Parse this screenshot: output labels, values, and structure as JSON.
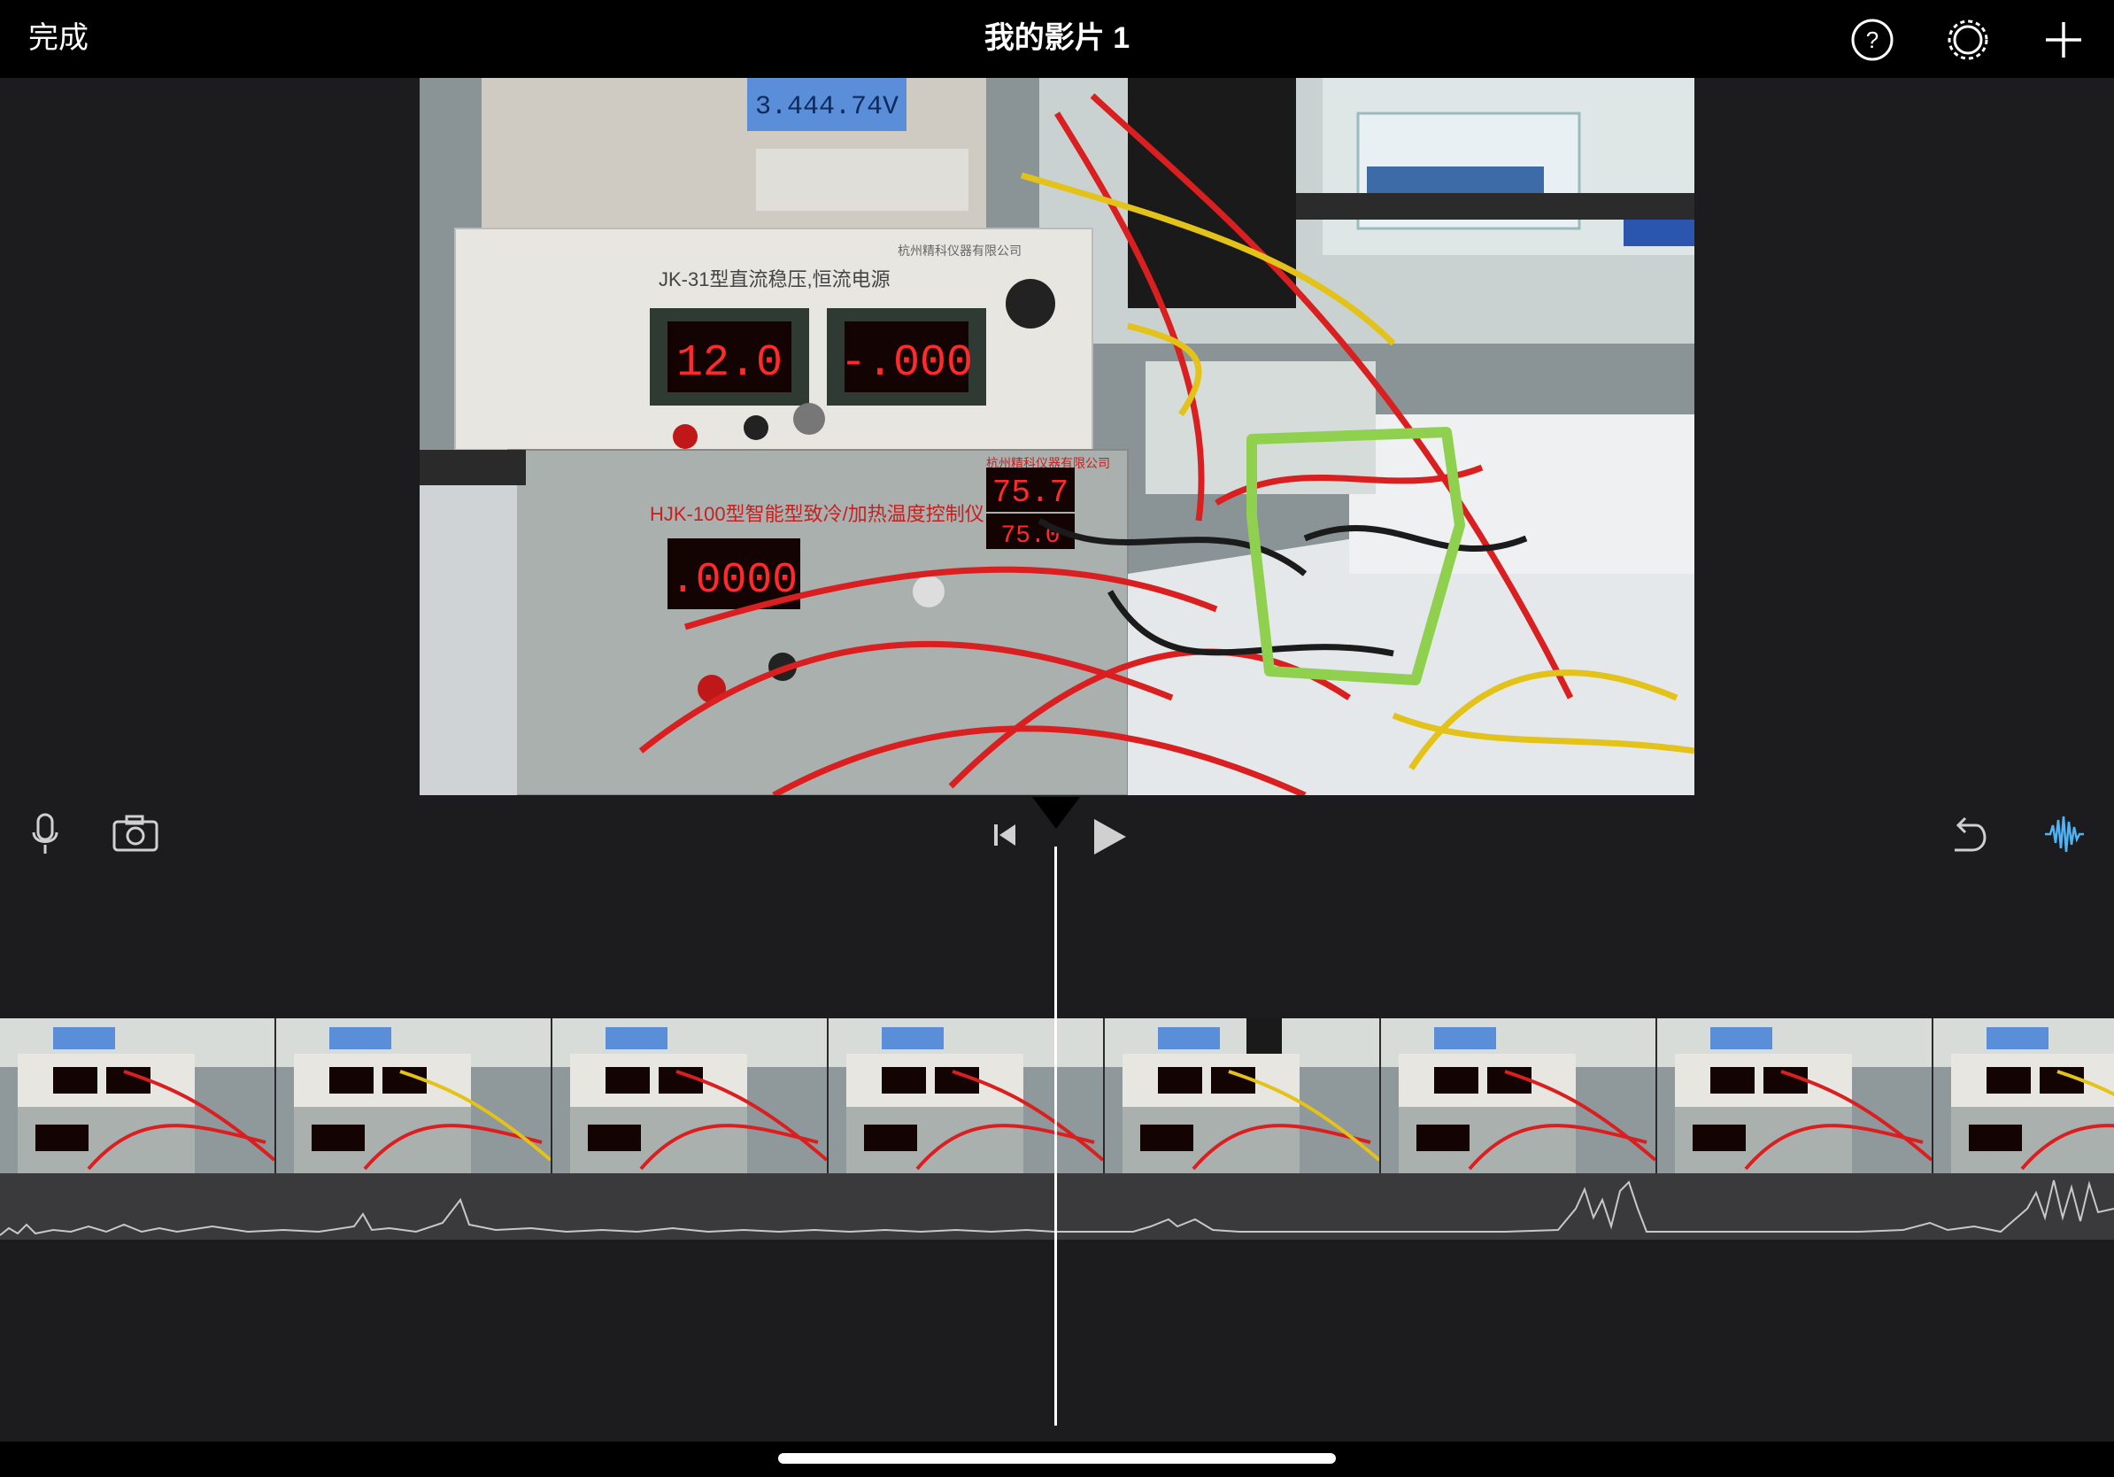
{
  "header": {
    "done_label": "完成",
    "title": "我的影片 1",
    "icons": [
      "help-icon",
      "settings-icon",
      "add-icon"
    ]
  },
  "viewer": {
    "main_display_reading": "3.444.74V",
    "power_supply_label": "JK-31型直流稳压,恒流电源",
    "power_supply_brand": "杭州精科仪器有限公司",
    "voltage_reading": "12.0",
    "current_reading": "-.000",
    "controller_label": "HJK-100型智能型致冷/加热温度控制仪",
    "controller_brand": "杭州精科仪器有限公司",
    "temp_reading_1": "75.7",
    "temp_reading_2": "75.0",
    "controller_main_reading": ".0000",
    "highlight_color": "#8fd14f"
  },
  "timeline": {
    "frame_count": 8,
    "icons": [
      "microphone-icon",
      "camera-icon",
      "skip-to-start-icon",
      "play-icon",
      "undo-icon",
      "audio-waveform-icon"
    ],
    "waveform_active_color": "#4fb3f6"
  }
}
